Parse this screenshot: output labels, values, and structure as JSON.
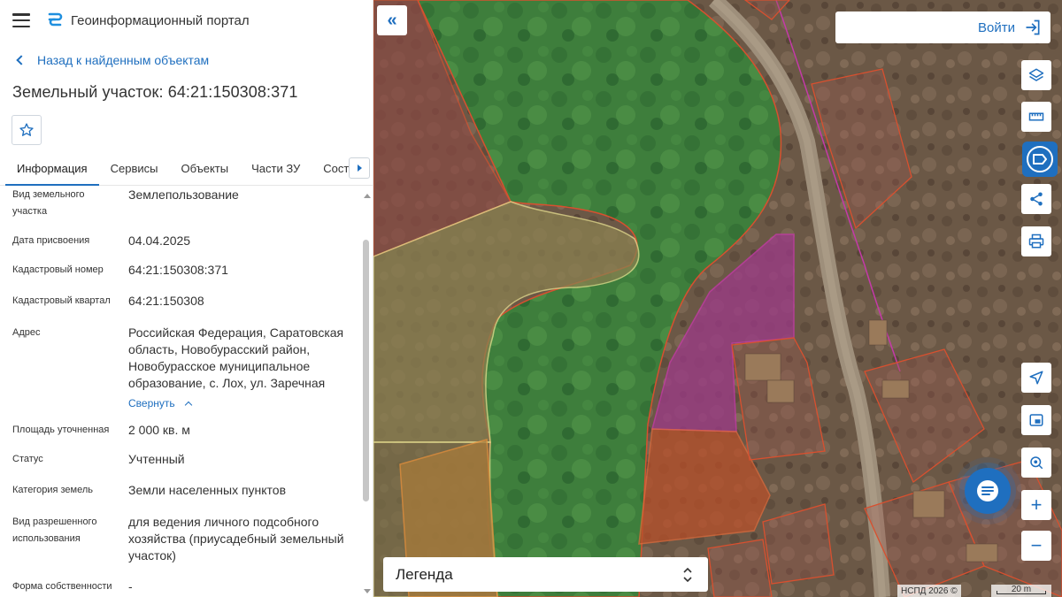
{
  "app": {
    "title": "Геоинформационный портал"
  },
  "nav": {
    "back_label": "Назад к найденным объектам"
  },
  "parcel": {
    "title": "Земельный участок: 64:21:150308:371"
  },
  "tabs": [
    {
      "label": "Информация",
      "active": true
    },
    {
      "label": "Сервисы"
    },
    {
      "label": "Объекты"
    },
    {
      "label": "Части ЗУ"
    },
    {
      "label": "Состав"
    }
  ],
  "info": {
    "rows": [
      {
        "label": "Вид земельного участка",
        "value": "Землепользование"
      },
      {
        "label": "Дата присвоения",
        "value": "04.04.2025"
      },
      {
        "label": "Кадастровый номер",
        "value": "64:21:150308:371"
      },
      {
        "label": "Кадастровый квартал",
        "value": "64:21:150308"
      },
      {
        "label": "Адрес",
        "value": "Российская Федерация, Саратовская область, Новобурасский район, Новобурасское муниципальное образование, с. Лох, ул. Заречная"
      },
      {
        "label": "Площадь уточненная",
        "value": "2 000 кв. м"
      },
      {
        "label": "Статус",
        "value": "Учтенный"
      },
      {
        "label": "Категория земель",
        "value": "Земли населенных пунктов"
      },
      {
        "label": "Вид разрешенного использования",
        "value": "для ведения личного подсобного хозяйства (приусадебный земельный участок)"
      },
      {
        "label": "Форма собственности",
        "value": "-"
      }
    ],
    "collapse_label": "Свернуть"
  },
  "map": {
    "login_label": "Войти",
    "legend_label": "Легенда",
    "attribution": "НСПД 2026 ©",
    "scale_label": "20 m",
    "zoom_in": "+",
    "zoom_out": "−",
    "collapse_icon": "«"
  },
  "colors": {
    "accent": "#1f6fbf",
    "parcel_green": "#3f8f3f",
    "parcel_magenta": "#b0338f",
    "parcel_orange": "#c8541f",
    "parcel_red_outline": "#d8502f"
  }
}
